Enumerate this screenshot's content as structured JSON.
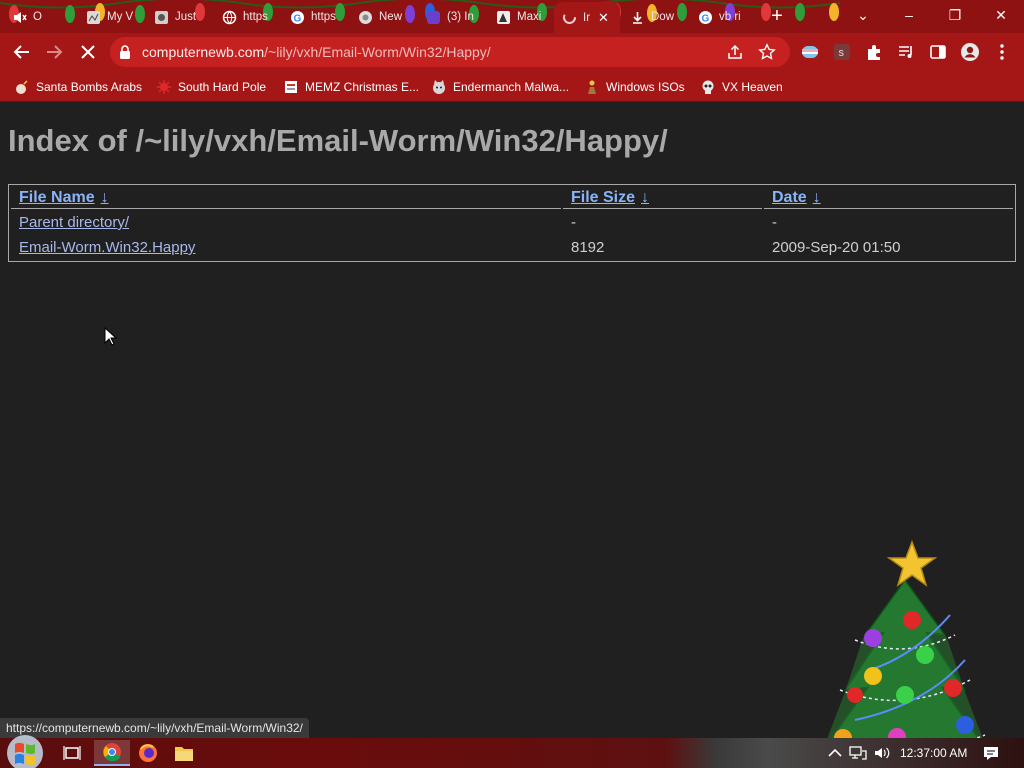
{
  "window": {
    "tabs": [
      {
        "label": "O",
        "icon": "audio-muted-icon"
      },
      {
        "label": "My V",
        "icon": "site-icon"
      },
      {
        "label": "Just",
        "icon": "site-icon"
      },
      {
        "label": "https",
        "icon": "globe-icon"
      },
      {
        "label": "https",
        "icon": "google-icon"
      },
      {
        "label": "New",
        "icon": "chrome-icon"
      },
      {
        "label": "(3) In",
        "icon": "site-icon"
      },
      {
        "label": "Maxi",
        "icon": "site-icon"
      },
      {
        "label": "Ir",
        "icon": "loading-icon",
        "active": true
      },
      {
        "label": "Dow",
        "icon": "download-icon"
      },
      {
        "label": "vb ri",
        "icon": "google-icon"
      }
    ],
    "new_tab": "+",
    "controls": {
      "menu": "⌄",
      "minimize": "–",
      "restore": "❐",
      "close": "✕"
    }
  },
  "toolbar": {
    "url_host": "computernewb.com",
    "url_path": "/~lily/vxh/Email-Worm/Win32/Happy/"
  },
  "bookmarks": [
    {
      "label": "Santa Bombs Arabs"
    },
    {
      "label": "South Hard Pole"
    },
    {
      "label": "MEMZ Christmas E..."
    },
    {
      "label": "Endermanch Malwa..."
    },
    {
      "label": "Windows ISOs"
    },
    {
      "label": "VX Heaven"
    }
  ],
  "page": {
    "title": "Index of /~lily/vxh/Email-Worm/Win32/Happy/",
    "columns": {
      "name": "File Name",
      "size": "File Size",
      "date": "Date",
      "sort_arrow": "↓"
    },
    "rows": [
      {
        "name": "Parent directory/",
        "size": "-",
        "date": "-"
      },
      {
        "name": "Email-Worm.Win32.Happy",
        "size": "8192",
        "date": "2009-Sep-20 01:50"
      }
    ]
  },
  "status_url": "https://computernewb.com/~lily/vxh/Email-Worm/Win32/",
  "taskbar": {
    "time": "12:37:00 AM"
  },
  "colors": {
    "theme_red": "#a51717",
    "link": "#8ab4f8",
    "page_bg": "#202020"
  }
}
